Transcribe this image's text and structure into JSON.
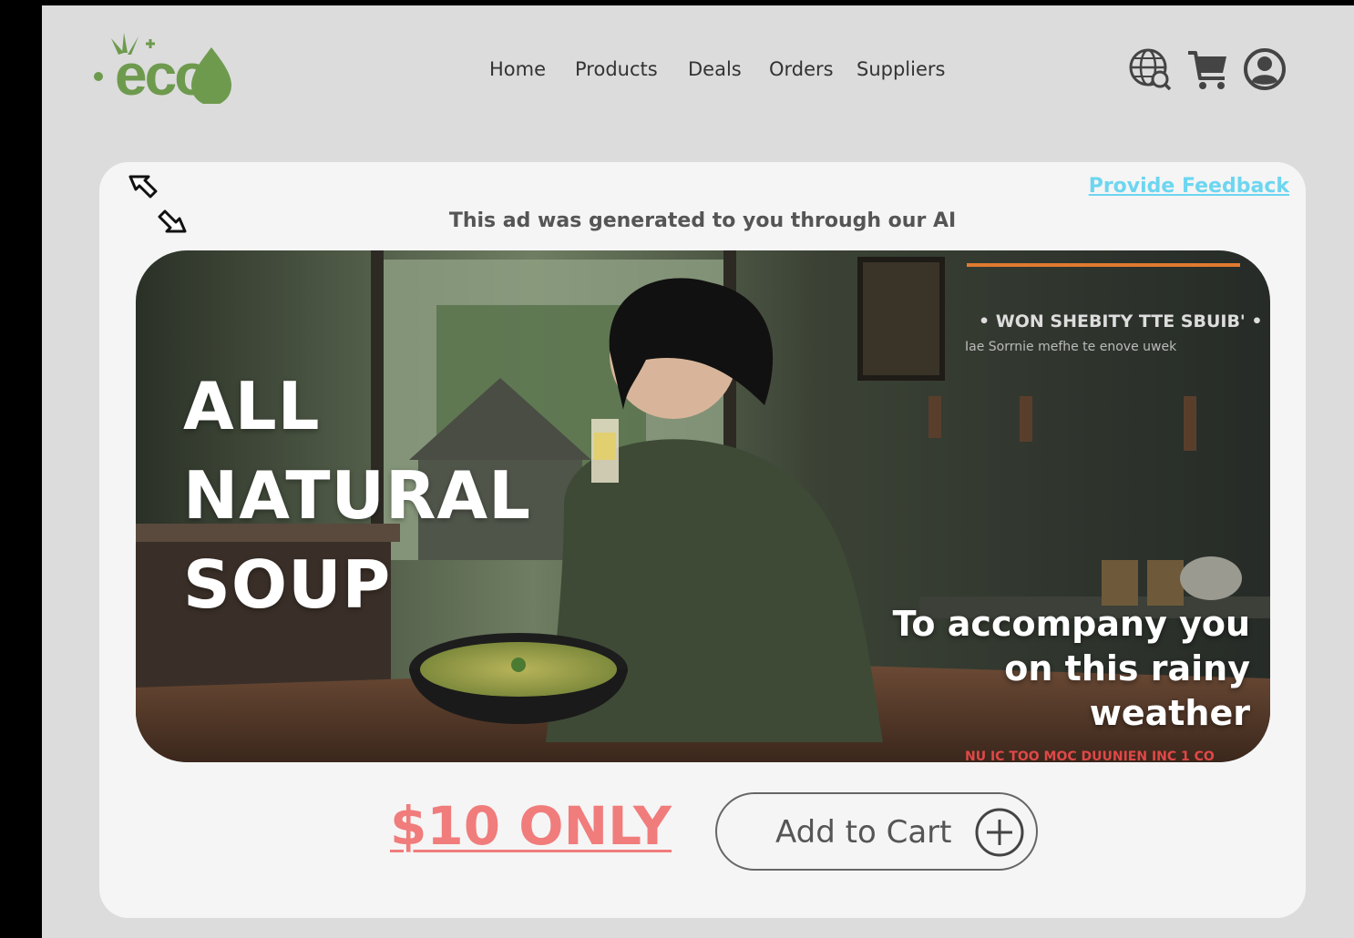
{
  "brand": {
    "logo_text": "eco",
    "color": "#6e9a4e"
  },
  "nav": {
    "items": [
      {
        "label": "Home"
      },
      {
        "label": "Products"
      },
      {
        "label": "Deals"
      },
      {
        "label": "Orders"
      },
      {
        "label": "Suppliers"
      }
    ]
  },
  "header_icons": [
    "globe-search-icon",
    "cart-icon",
    "user-account-icon"
  ],
  "ad": {
    "feedback_link": "Provide Feedback",
    "ai_note": "This ad was generated to you through our AI",
    "headline": [
      "ALL",
      "NATURAL",
      "SOUP"
    ],
    "tagline": [
      "To accompany you",
      "on this rainy",
      "weather"
    ],
    "price": "$10 ONLY",
    "add_to_cart_label": "Add to Cart",
    "colors": {
      "price": "#f07c7c",
      "feedback": "#6dd6f0"
    }
  }
}
